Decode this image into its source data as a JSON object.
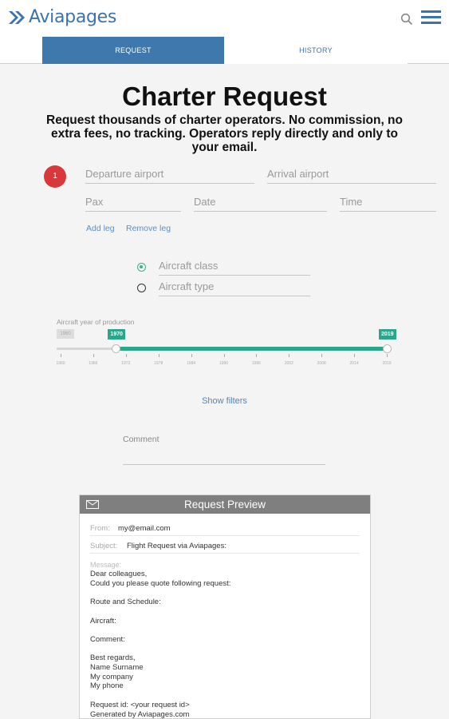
{
  "brand": {
    "name": "Aviapages",
    "color": "#3a73ad"
  },
  "header": {
    "search_icon": "search-icon",
    "menu_icon": "hamburger-menu-icon"
  },
  "tabs": [
    {
      "label": "REQUEST",
      "active": true
    },
    {
      "label": "HISTORY",
      "active": false
    }
  ],
  "page": {
    "title": "Charter Request",
    "subtitle": "Request thousands of charter operators. No commission, no extra fees, no tracking. Operators reply directly and only to your email."
  },
  "leg": {
    "step_number": "1",
    "departure_placeholder": "Departure airport",
    "arrival_placeholder": "Arrival airport",
    "pax_placeholder": "Pax",
    "date_placeholder": "Date",
    "time_placeholder": "Time",
    "add_leg": "Add leg",
    "remove_leg": "Remove leg"
  },
  "aircraft": {
    "class_placeholder": "Aircraft class",
    "type_placeholder": "Aircraft type",
    "selected": "class"
  },
  "year_slider": {
    "label": "Aircraft year of production",
    "min": 1960,
    "max": 2019,
    "from": 1970,
    "to": 2019,
    "min_label": "1960",
    "from_label": "1970",
    "to_label": "2019",
    "ticks": [
      "1960",
      "1966",
      "1972",
      "1978",
      "1984",
      "1990",
      "1996",
      "2002",
      "2008",
      "2014",
      "2019"
    ],
    "accent": "#2aa689"
  },
  "show_filters": "Show filters",
  "comment_label": "Comment",
  "preview": {
    "title": "Request Preview",
    "from_label": "From:",
    "from_value": "my@email.com",
    "subject_label": "Subject:",
    "subject_value": "Flight Request via Aviapages:",
    "message_label": "Message:",
    "message_body": "Dear colleagues,\nCould you please quote following request:\n\nRoute and Schedule:\n\nAircraft:\n\nComment:\n\nBest regards,\nName Surname\nMy company\nMy phone\n\nRequest id: <your request id>\nGenerated by Aviapages.com"
  },
  "colors": {
    "tab_active": "#3f78ad",
    "step_badge": "#d9383a",
    "preview_header": "#7f7f7f"
  }
}
